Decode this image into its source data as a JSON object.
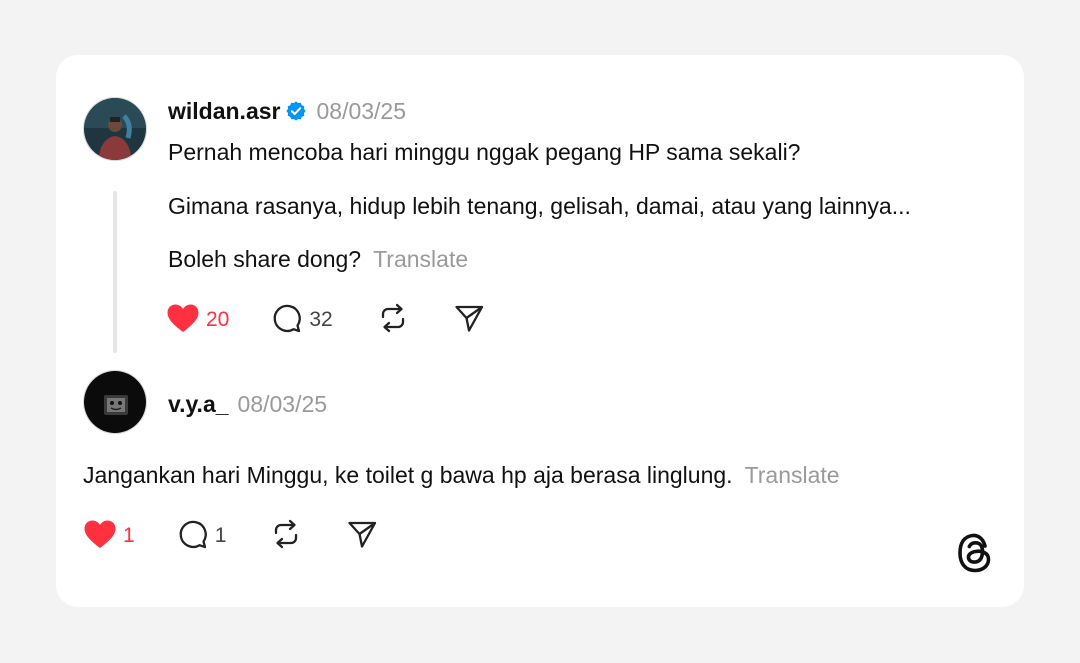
{
  "post": {
    "username": "wildan.asr",
    "verified": true,
    "date": "08/03/25",
    "lines": [
      "Pernah mencoba hari minggu nggak pegang HP sama sekali?",
      "Gimana rasanya, hidup lebih tenang, gelisah, damai, atau yang lainnya...",
      "Boleh share dong?"
    ],
    "translate_label": "Translate",
    "likes": "20",
    "replies": "32",
    "liked": true
  },
  "reply": {
    "username": "v.y.a_",
    "date": "08/03/25",
    "text": "Jangankan hari Minggu, ke toilet g bawa hp aja berasa linglung.",
    "translate_label": "Translate",
    "likes": "1",
    "replies": "1",
    "liked": true
  },
  "icons": {
    "like": "heart-icon",
    "reply": "speech-bubble-icon",
    "repost": "repost-icon",
    "share": "paper-plane-icon",
    "verified": "verified-badge-icon",
    "brand": "threads-logo-icon"
  },
  "colors": {
    "like": "#ff3040",
    "verified": "#0095f6",
    "muted": "#9a9a9a",
    "card": "#ffffff",
    "background": "#f3f3f3"
  }
}
